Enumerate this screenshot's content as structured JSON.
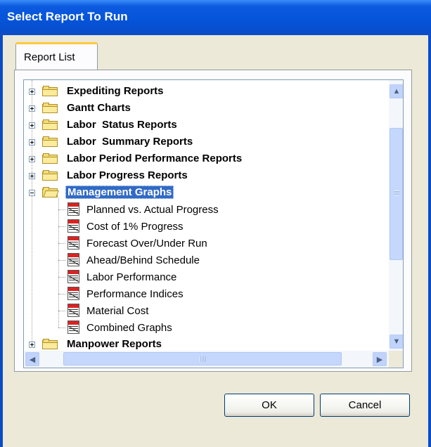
{
  "window": {
    "title": "Select Report To Run"
  },
  "tabs": [
    {
      "label": "Report List"
    }
  ],
  "tree": {
    "folders_before": [
      {
        "label": "Expediting Reports"
      },
      {
        "label": "Gantt Charts"
      },
      {
        "label": "Labor  Status Reports"
      },
      {
        "label": "Labor  Summary Reports"
      },
      {
        "label": "Labor Period Performance Reports"
      },
      {
        "label": "Labor Progress Reports"
      }
    ],
    "open_folder": {
      "label": "Management Graphs",
      "items": [
        {
          "label": "Planned vs. Actual Progress"
        },
        {
          "label": "Cost of 1% Progress"
        },
        {
          "label": "Forecast Over/Under Run"
        },
        {
          "label": "Ahead/Behind Schedule"
        },
        {
          "label": "Labor Performance"
        },
        {
          "label": "Performance Indices"
        },
        {
          "label": "Material Cost"
        },
        {
          "label": "Combined Graphs"
        }
      ]
    },
    "folders_after": [
      {
        "label": "Manpower Reports"
      }
    ],
    "icons": {
      "folder": "folder-icon",
      "report": "report-icon",
      "expand": "plus-box-icon",
      "collapse": "minus-box-icon"
    }
  },
  "scrollbars": {
    "up": "▲",
    "down": "▼",
    "left": "◀",
    "right": "▶"
  },
  "buttons": {
    "ok": "OK",
    "cancel": "Cancel"
  },
  "colors": {
    "titlebar": "#0553D8",
    "selection": "#316AC5",
    "dialog_bg": "#ECE9D8"
  }
}
